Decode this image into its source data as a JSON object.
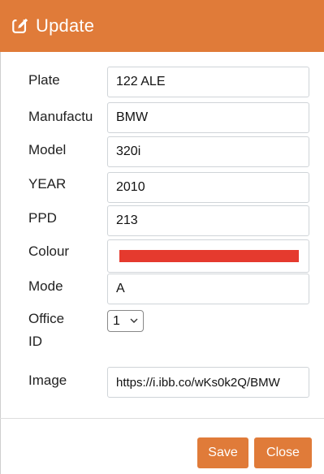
{
  "colors": {
    "header_bg": "#e07b39",
    "button_bg": "#e07b39",
    "colour_swatch": "#e53a2e"
  },
  "header": {
    "icon": "edit-icon",
    "title": "Update"
  },
  "form": {
    "plate": {
      "label": "Plate",
      "value": "122 ALE"
    },
    "manufacturer": {
      "label": "Manufactu",
      "value": "BMW"
    },
    "model": {
      "label": "Model",
      "value": "320i"
    },
    "year": {
      "label": "YEAR",
      "value": "2010"
    },
    "ppd": {
      "label": "PPD",
      "value": "213"
    },
    "colour": {
      "label": "Colour",
      "value": "#e53a2e"
    },
    "mode": {
      "label": "Mode",
      "value": "A"
    },
    "office_id": {
      "label_line1": "Office",
      "label_line2": "ID",
      "value": "1"
    },
    "image": {
      "label": "Image",
      "value": "https://i.ibb.co/wKs0k2Q/BMW"
    }
  },
  "footer": {
    "save_label": "Save",
    "close_label": "Close"
  }
}
